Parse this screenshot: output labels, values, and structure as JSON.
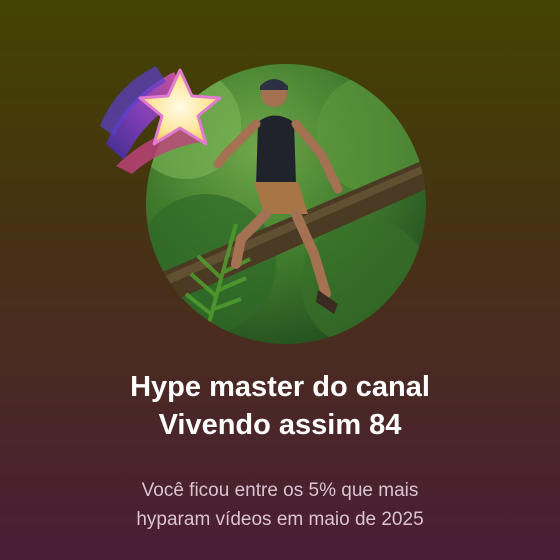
{
  "card": {
    "title_line1": "Hype master do canal",
    "title_line2": "Vivendo assim 84",
    "subtitle_line1": "Você ficou entre os 5% que mais",
    "subtitle_line2": "hyparam vídeos em maio de 2025"
  },
  "icons": {
    "badge": "star-icon",
    "avatar": "channel-avatar"
  },
  "colors": {
    "background_top": "#434402",
    "background_bottom": "#4a1d36",
    "title": "#ffffff",
    "subtitle": "#d9c4cf"
  }
}
